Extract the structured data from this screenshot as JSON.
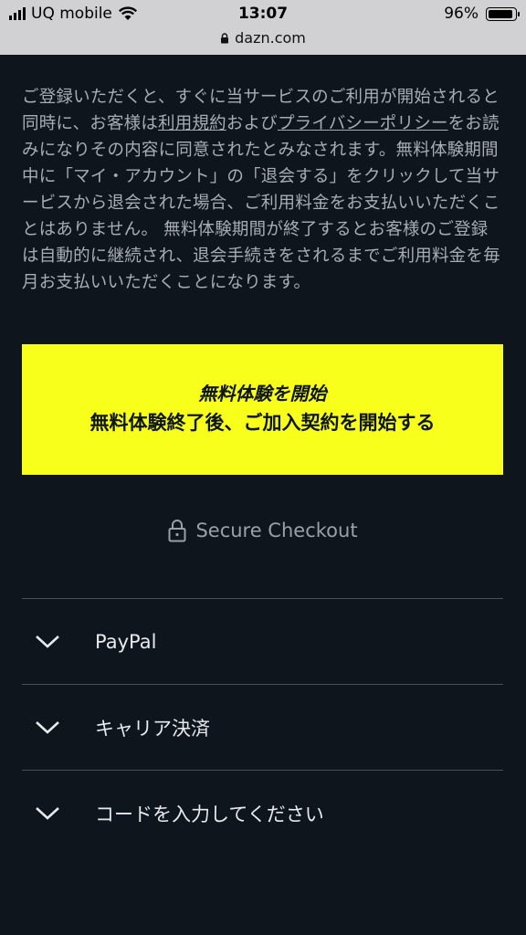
{
  "status": {
    "carrier": "UQ mobile",
    "time": "13:07",
    "battery": "96%",
    "battery_level": 0.96,
    "url": "dazn.com"
  },
  "legal": {
    "part1": "ご登録いただくと、すぐに当サービスのご利用が開始されると同時に、お客様は",
    "terms_link": "利用規約",
    "part2": "および",
    "privacy_link": "プライバシーポリシー",
    "part3": "をお読みになりその内容に同意されたとみなされます。無料体験期間中に「マイ・アカウント」の「退会する」をクリックして当サービスから退会された場合、ご利用料金をお支払いいただくことはありません。 無料体験期間が終了するとお客様のご登録は自動的に継続され、退会手続きをされるまでご利用料金を毎月お支払いいただくことになります。"
  },
  "cta": {
    "title": "無料体験を開始",
    "subtitle": "無料体験終了後、ご加入契約を開始する",
    "color": "#f7ff1a"
  },
  "secure_label": "Secure Checkout",
  "payment_options": [
    {
      "label": "PayPal"
    },
    {
      "label": "キャリア決済"
    },
    {
      "label": "コードを入力してください"
    }
  ]
}
